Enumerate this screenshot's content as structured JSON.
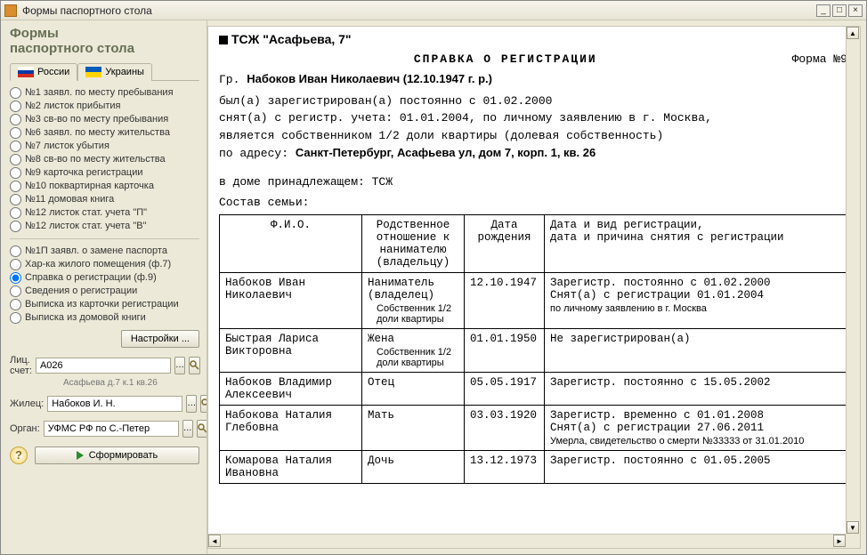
{
  "window": {
    "title": "Формы паспортного стола"
  },
  "sidebar": {
    "heading": "Формы\nпаспортного стола",
    "tabs": [
      {
        "label": "России",
        "flag": "ru",
        "active": true
      },
      {
        "label": "Украины",
        "flag": "ua",
        "active": false
      }
    ],
    "forms_group1": [
      "№1  заявл. по месту пребывания",
      "№2  листок прибытия",
      "№3  св-во по месту пребывания",
      "№6  заявл. по месту жительства",
      "№7  листок убытия",
      "№8  св-во по месту жительства",
      "№9  карточка регистрации",
      "№10 поквартирная карточка",
      "№11 домовая книга",
      "№12 листок стат. учета \"П\"",
      "№12 листок стат. учета \"В\""
    ],
    "forms_group2": [
      "№1П  заявл. о замене паспорта",
      "Хар-ка жилого помещения (ф.7)",
      "Справка о регистрации (ф.9)",
      "Сведения о регистрации",
      "Выписка из карточки регистрации",
      "Выписка из домовой книги"
    ],
    "selected_group2_index": 2,
    "settings_btn": "Настройки ...",
    "fields": {
      "account_label": "Лиц. счет:",
      "account_value": "А026",
      "account_hint": "Асафьева д.7 к.1 кв.26",
      "resident_label": "Жилец:",
      "resident_value": "Набоков И. Н.",
      "organ_label": "Орган:",
      "organ_value": "УФМС РФ по С.-Петер"
    },
    "generate_btn": "Сформировать"
  },
  "doc": {
    "org": "ТСЖ \"Асафьева, 7\"",
    "title": "СПРАВКА О РЕГИСТРАЦИИ",
    "form_no": "Форма №9",
    "person_line_prefix": "Гр.  ",
    "person_name": "Набоков Иван Николаевич (12.10.1947 г. р.)",
    "line1": "был(а) зарегистрирован(а) постоянно с 01.02.2000",
    "line2": "снят(а) с регистр. учета: 01.01.2004, по личному заявлению в г. Москва,",
    "line3": "является собственником 1/2 доли квартиры (долевая собственность)",
    "addr_prefix": "по адресу:  ",
    "addr": "Санкт-Петербург, Асафьева ул, дом 7, корп. 1, кв. 26",
    "house_line": "в доме принадлежащем: ТСЖ",
    "family_label": "Состав семьи:",
    "table": {
      "headers": [
        "Ф.И.О.",
        "Родственное отношение к нанимателю (владельцу)",
        "Дата рождения",
        "Дата и вид регистрации,\nдата и причина снятия с регистрации"
      ],
      "rows": [
        {
          "fio": "Набоков Иван Николаевич",
          "rel": "Наниматель (владелец)",
          "rel_sub": "Собственник 1/2 доли квартиры",
          "dob": "12.10.1947",
          "reg": "Зарегистр. постоянно с 01.02.2000\nСнят(а) с регистрации  01.01.2004",
          "reg_sub": "по личному заявлению в г. Москва"
        },
        {
          "fio": "Быстрая Лариса Викторовна",
          "rel": "Жена",
          "rel_sub": "Собственник 1/2 доли квартиры",
          "dob": "01.01.1950",
          "reg": "Не зарегистрирован(а)",
          "reg_sub": ""
        },
        {
          "fio": "Набоков Владимир Алексеевич",
          "rel": "Отец",
          "rel_sub": "",
          "dob": "05.05.1917",
          "reg": "Зарегистр. постоянно с 15.05.2002",
          "reg_sub": ""
        },
        {
          "fio": "Набокова Наталия Глебовна",
          "rel": "Мать",
          "rel_sub": "",
          "dob": "03.03.1920",
          "reg": "Зарегистр. временно с 01.01.2008\nСнят(а) с регистрации  27.06.2011",
          "reg_sub": "Умерла, свидетельство о смерти №33333 от 31.01.2010"
        },
        {
          "fio": "Комарова Наталия Ивановна",
          "rel": "Дочь",
          "rel_sub": "",
          "dob": "13.12.1973",
          "reg": "Зарегистр. постоянно с 01.05.2005",
          "reg_sub": ""
        }
      ]
    }
  }
}
